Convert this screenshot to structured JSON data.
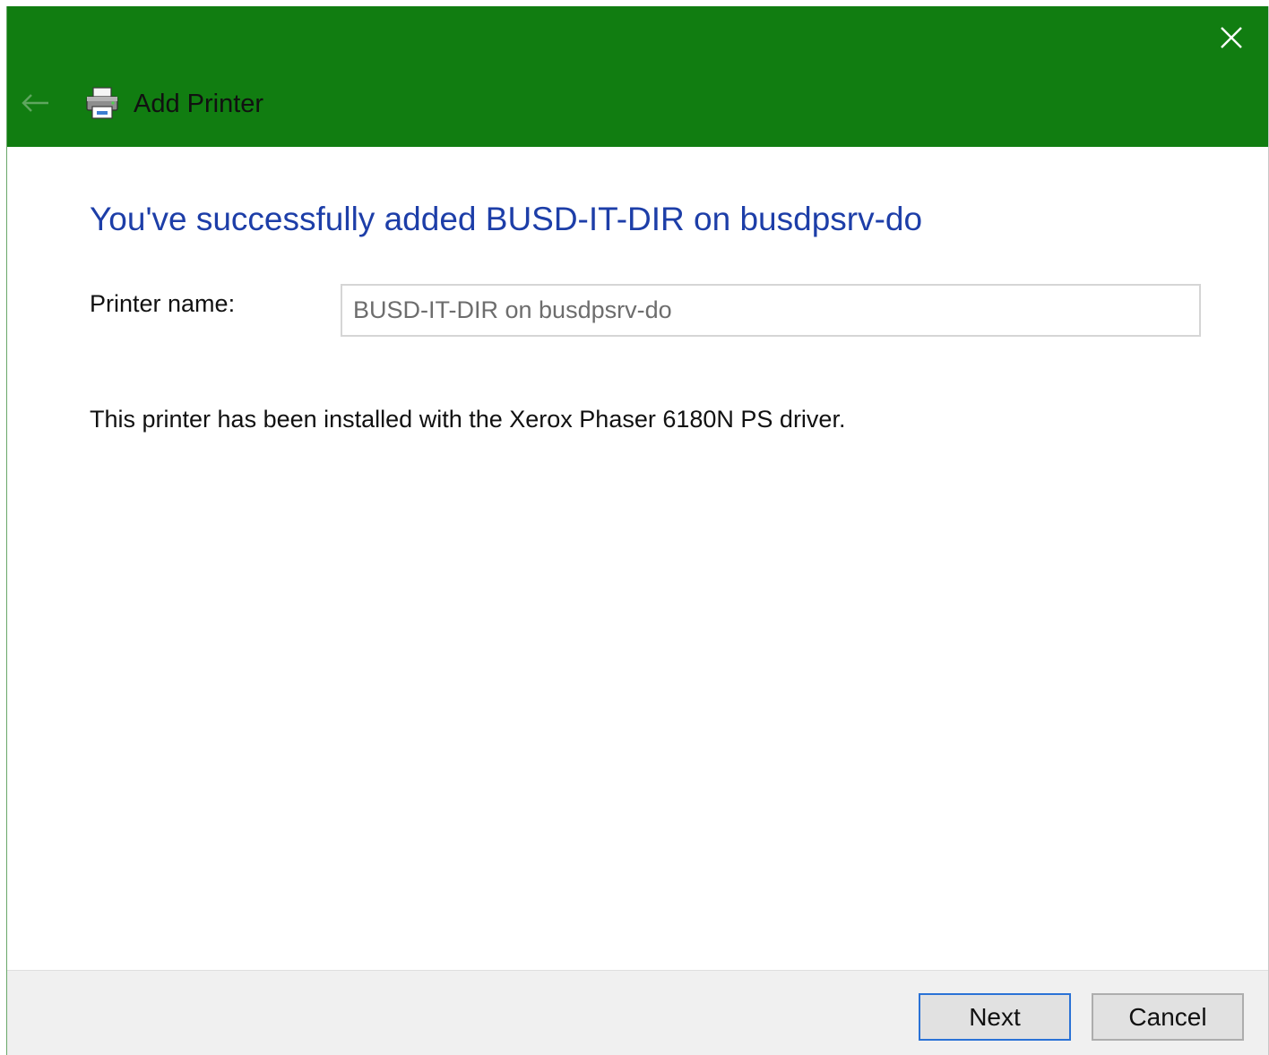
{
  "window": {
    "title": "Add Printer",
    "accent_color": "#117d11",
    "icons": {
      "back": "back-arrow-icon",
      "printer": "printer-icon",
      "close": "close-icon"
    }
  },
  "content": {
    "heading": "You've successfully added BUSD-IT-DIR on busdpsrv-do",
    "printer_name_label": "Printer name:",
    "printer_name_value": "BUSD-IT-DIR on busdpsrv-do",
    "info": "This printer has been installed with the Xerox Phaser 6180N PS driver."
  },
  "footer": {
    "next_label": "Next",
    "cancel_label": "Cancel"
  }
}
